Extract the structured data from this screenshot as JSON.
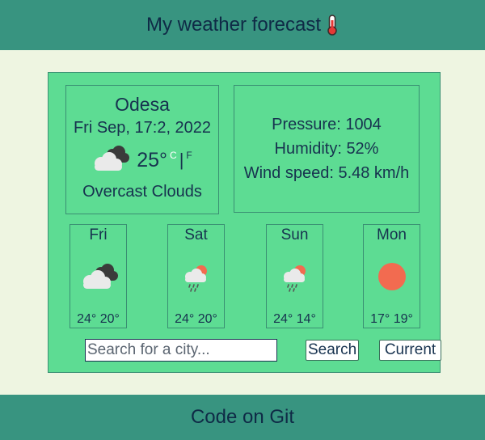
{
  "header": {
    "title": "My weather forecast",
    "icon": "thermometer-icon"
  },
  "current": {
    "city": "Odesa",
    "date": "Fri Sep, 17:2, 2022",
    "temperature": "25°",
    "unit_c": "C",
    "unit_sep": "|",
    "unit_f": "F",
    "description": "Overcast Clouds",
    "icon": "overcast-clouds-icon"
  },
  "details": {
    "pressure": "Pressure: 1004",
    "humidity": "Humidity: 52%",
    "wind": "Wind speed: 5.48 km/h"
  },
  "forecast": [
    {
      "day": "Fri",
      "temps": "24° 20°",
      "icon": "overcast-clouds-icon"
    },
    {
      "day": "Sat",
      "temps": "24° 20°",
      "icon": "sun-rain-cloud-icon"
    },
    {
      "day": "Sun",
      "temps": "24° 14°",
      "icon": "sun-rain-cloud-icon"
    },
    {
      "day": "Mon",
      "temps": "17° 19°",
      "icon": "sun-icon"
    }
  ],
  "search": {
    "placeholder": "Search for a city...",
    "value": ""
  },
  "buttons": {
    "search": "Search",
    "current": "Current"
  },
  "footer": {
    "link": "Code on Git"
  },
  "colors": {
    "bar": "#389480",
    "card": "#5ddc93",
    "background": "#eef5e1",
    "sun": "#f26b50"
  }
}
